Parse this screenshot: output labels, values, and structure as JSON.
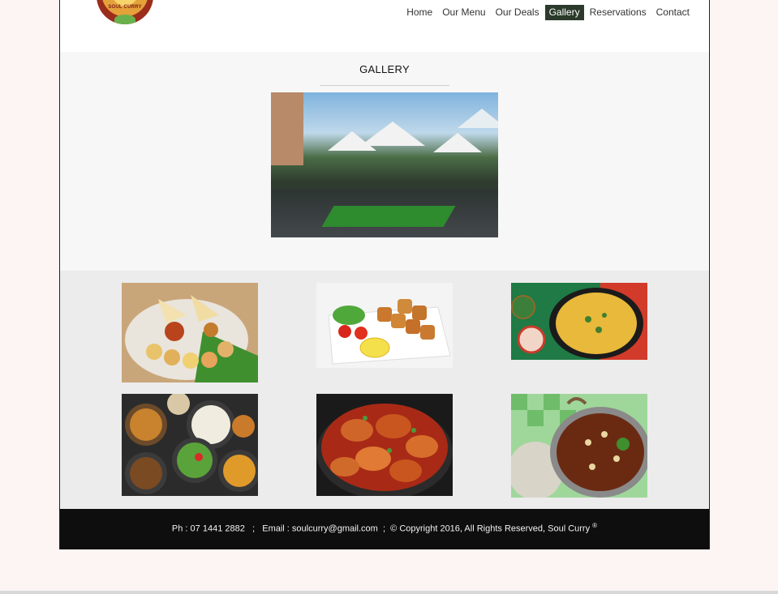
{
  "brand": {
    "logo_text": "SOUL CURRY"
  },
  "nav": {
    "items": [
      {
        "label": "Home"
      },
      {
        "label": "Our Menu"
      },
      {
        "label": "Our Deals"
      },
      {
        "label": "Gallery",
        "active": true
      },
      {
        "label": "Reservations"
      },
      {
        "label": "Contact"
      }
    ]
  },
  "gallery": {
    "title": "GALLERY",
    "hero_image": "outdoor-dining-terrace",
    "thumbnails": [
      {
        "image": "dosa-platter"
      },
      {
        "image": "chicken-skewers"
      },
      {
        "image": "yellow-curry-bowl"
      },
      {
        "image": "thali-spread"
      },
      {
        "image": "chilli-chicken"
      },
      {
        "image": "black-eyed-pea-curry"
      }
    ]
  },
  "footer": {
    "phone": "Ph : 07 1441 2882",
    "sep1": ";",
    "email": "Email : soulcurry@gmail.com",
    "sep2": ";",
    "copyright": "© Copyright 2016,  All Rights Reserved,  Soul Curry",
    "registered": "®"
  },
  "colors": {
    "page_bg": "#fdf4f4",
    "nav_active": "#2b3a2a",
    "footer_bg": "#0e0e0e",
    "thumb_section_bg": "#ececec",
    "hero_section_bg": "#f7f7f7"
  }
}
